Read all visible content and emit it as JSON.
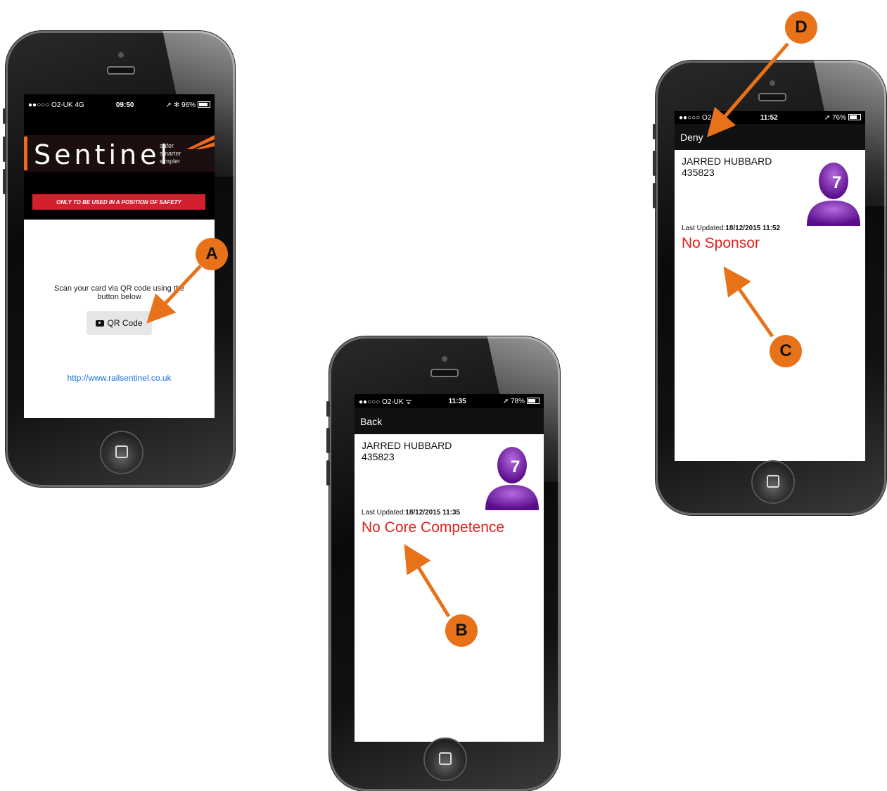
{
  "phone_a": {
    "status": {
      "carrier": "●●○○○ O2-UK  4G",
      "time": "09:50",
      "battery": "96%"
    },
    "logo": {
      "word": "Sentinel",
      "tag1": "safer",
      "tag2": "smarter",
      "tag3": "simpler"
    },
    "warning": "ONLY TO BE USED IN A POSITION OF SAFETY",
    "scan_text": "Scan your card via QR code using the button below",
    "qr_button": "QR Code",
    "link": "http://www.railsentinel.co.uk"
  },
  "phone_b": {
    "status": {
      "carrier": "●●○○○ O2-UK ᯤ",
      "time": "11:35",
      "battery": "78%"
    },
    "nav": "Back",
    "name": "JARRED HUBBARD",
    "id": "435823",
    "updated_label": "Last Updated:",
    "updated_value": "18/12/2015 11:35",
    "status_text": "No Core Competence",
    "avatar_number": "7"
  },
  "phone_c": {
    "status": {
      "carrier": "●●○○○ O2-",
      "time": "11:52",
      "battery": "76%"
    },
    "nav": "Deny",
    "name": "JARRED HUBBARD",
    "id": "435823",
    "updated_label": "Last Updated:",
    "updated_value": "18/12/2015 11:52",
    "status_text": "No Sponsor",
    "avatar_number": "7"
  },
  "markers": {
    "a": "A",
    "b": "B",
    "c": "C",
    "d": "D"
  },
  "colors": {
    "marker": "#e8721a",
    "alert": "#e02020",
    "link": "#1a6fd6"
  }
}
